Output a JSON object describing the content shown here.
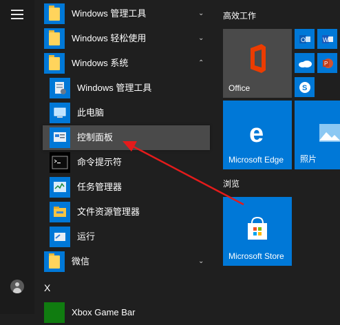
{
  "list": {
    "items": [
      {
        "label": "Windows 管理工具",
        "chevron": "⌄"
      },
      {
        "label": "Windows 轻松使用",
        "chevron": "⌄"
      },
      {
        "label": "Windows 系统",
        "chevron": "⌃"
      },
      {
        "label": "Windows 管理工具"
      },
      {
        "label": "此电脑"
      },
      {
        "label": "控制面板"
      },
      {
        "label": "命令提示符"
      },
      {
        "label": "任务管理器"
      },
      {
        "label": "文件资源管理器"
      },
      {
        "label": "运行"
      },
      {
        "label": "微信",
        "chevron": "⌄"
      },
      {
        "label": "Xbox Game Bar"
      }
    ],
    "letter_x": "X"
  },
  "tiles": {
    "group1": "高效工作",
    "group2": "浏览",
    "office": "Office",
    "edge": "Microsoft Edge",
    "photos": "照片",
    "store": "Microsoft Store"
  },
  "colors": {
    "accent": "#0078d7",
    "arrow": "#e41b1b",
    "background": "#1f1f1f"
  }
}
